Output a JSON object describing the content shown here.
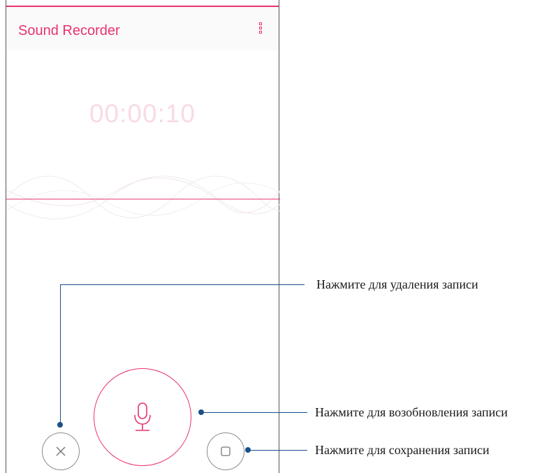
{
  "app": {
    "title": "Sound Recorder",
    "accent_color": "#e8336e",
    "menu_icon": "overflow-menu-icon"
  },
  "recorder": {
    "elapsed": "00:00:10",
    "state": "paused"
  },
  "controls": {
    "cancel_icon": "close-icon",
    "record_icon": "microphone-icon",
    "stop_icon": "stop-icon"
  },
  "callouts": {
    "delete": "Нажмите для удаления записи",
    "resume": "Нажмите для возобновления записи",
    "save": "Нажмите для сохранения записи",
    "color": "#1a4f8a"
  }
}
